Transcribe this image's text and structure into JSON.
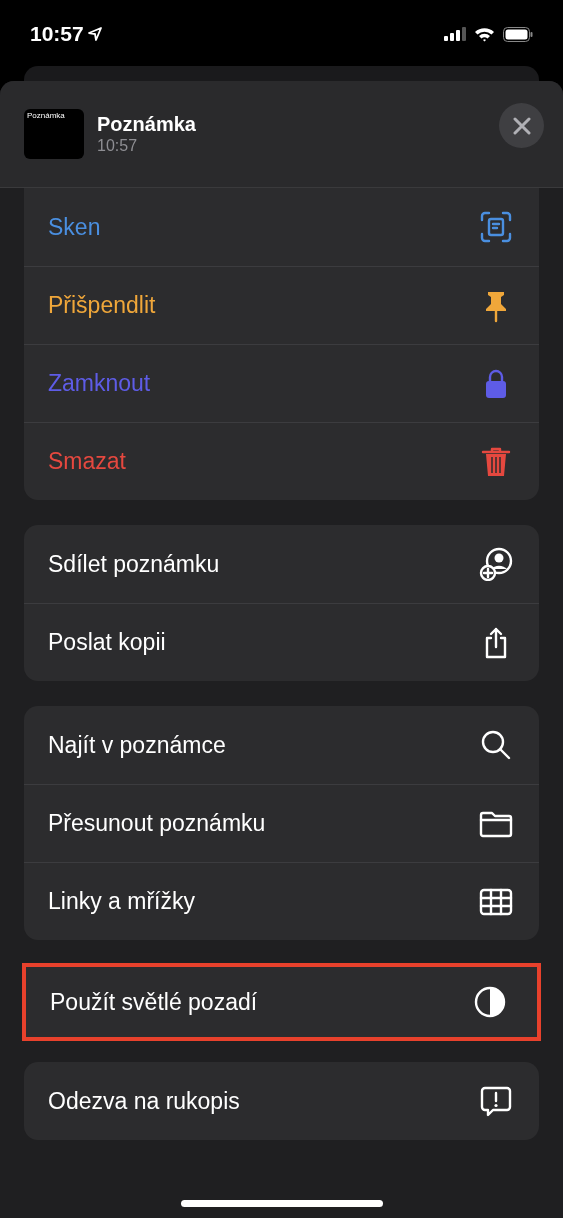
{
  "status_bar": {
    "time": "10:57"
  },
  "header": {
    "thumbnail_text": "Poznámka",
    "title": "Poznámka",
    "subtitle": "10:57"
  },
  "groups": [
    {
      "highlighted": false,
      "items": [
        {
          "label": "Sken",
          "color": "#4a8fe0"
        },
        {
          "label": "Přišpendlit",
          "color": "#f0a73a"
        },
        {
          "label": "Zamknout",
          "color": "#5e5ce6"
        },
        {
          "label": "Smazat",
          "color": "#e5483f"
        }
      ]
    },
    {
      "highlighted": false,
      "items": [
        {
          "label": "Sdílet poznámku"
        },
        {
          "label": "Poslat kopii"
        }
      ]
    },
    {
      "highlighted": false,
      "items": [
        {
          "label": "Najít v poznámce"
        },
        {
          "label": "Přesunout poznámku"
        },
        {
          "label": "Linky a mřížky"
        }
      ]
    },
    {
      "highlighted": true,
      "items": [
        {
          "label": "Použít světlé pozadí"
        }
      ]
    },
    {
      "highlighted": false,
      "items": [
        {
          "label": "Odezva na rukopis"
        }
      ]
    }
  ]
}
